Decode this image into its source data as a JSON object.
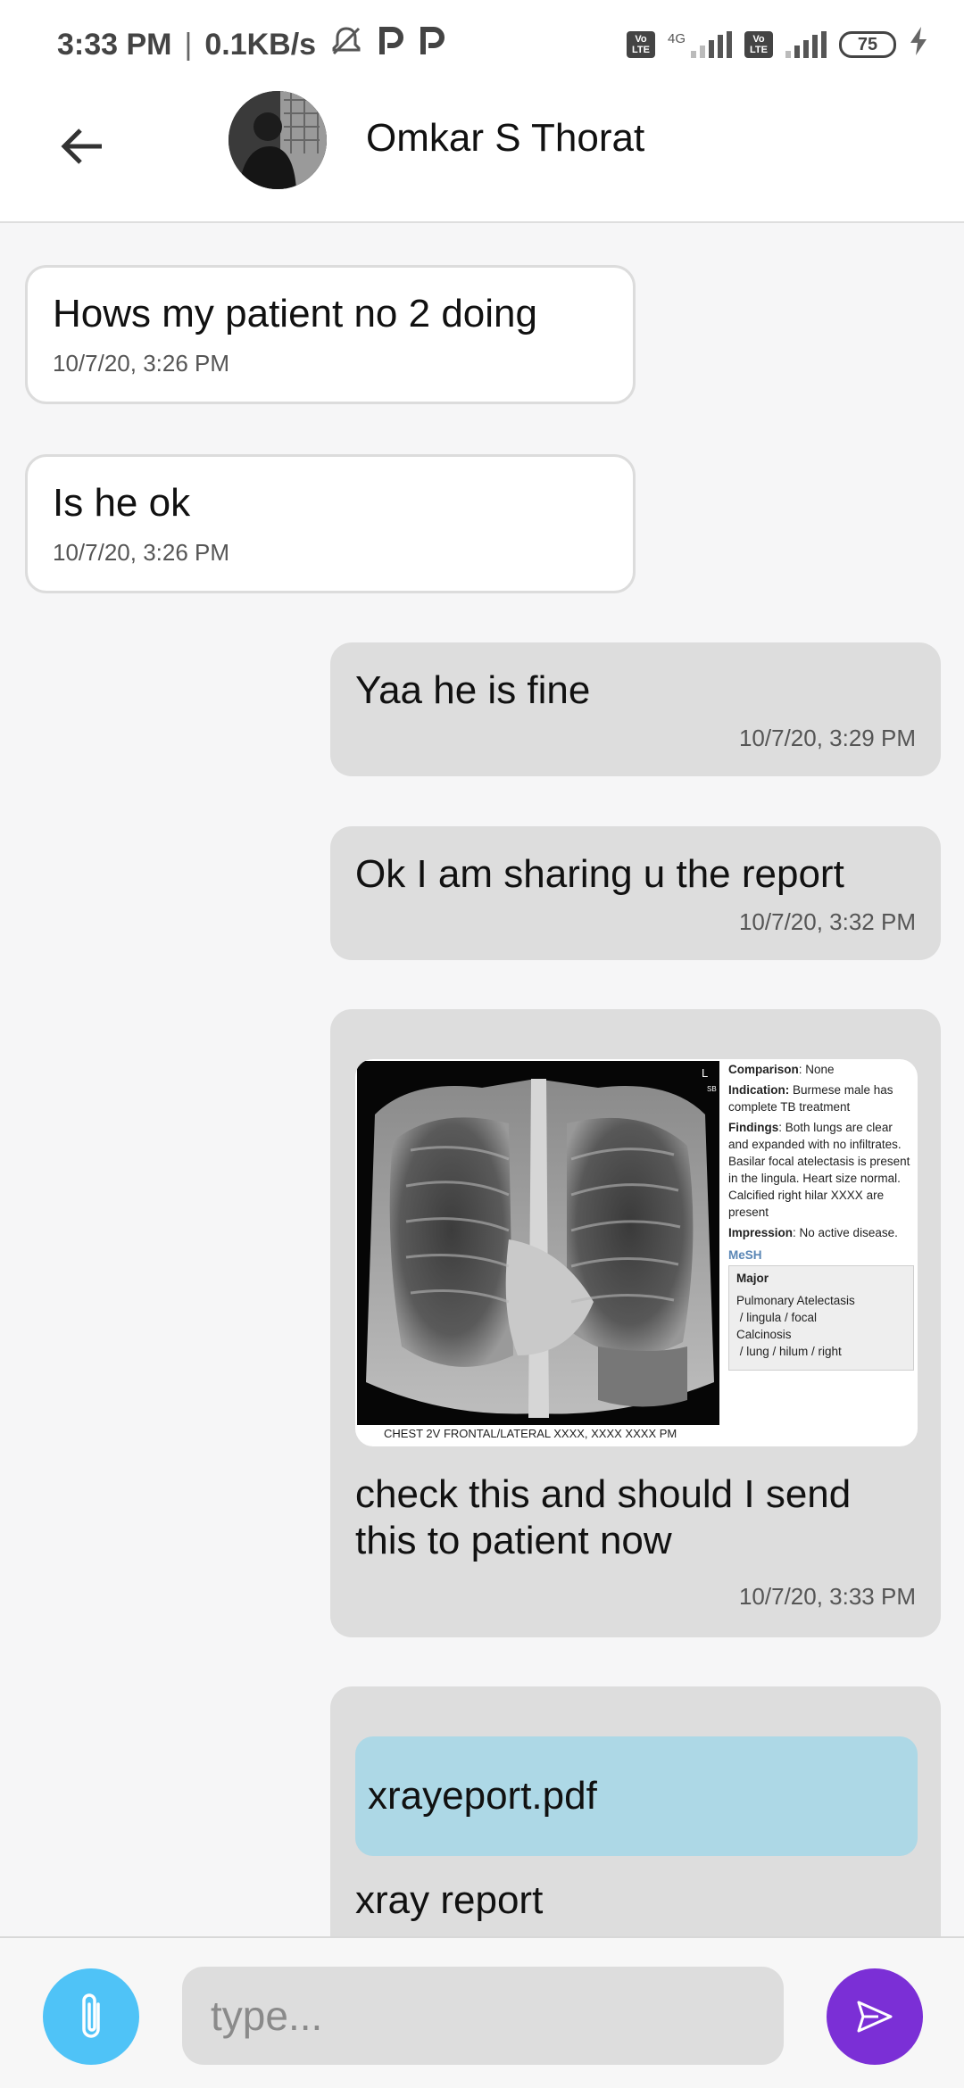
{
  "status_bar": {
    "time": "3:33 PM",
    "separator": "|",
    "speed": "0.1KB/s",
    "network_label": "4G",
    "volte_top": "Vo",
    "volte_bottom": "LTE",
    "battery": "75",
    "icons": [
      "mute-icon",
      "p-app-icon",
      "signal-icon",
      "battery-icon",
      "charging-icon"
    ]
  },
  "header": {
    "contact_name": "Omkar S Thorat",
    "back_icon": "arrow-left-icon"
  },
  "messages": [
    {
      "direction": "incoming",
      "text": "Hows my patient no 2 doing",
      "time": "10/7/20, 3:26 PM"
    },
    {
      "direction": "incoming",
      "text": "Is he ok",
      "time": "10/7/20, 3:26 PM"
    },
    {
      "direction": "outgoing",
      "text": "Yaa he is fine",
      "time": "10/7/20, 3:29 PM"
    },
    {
      "direction": "outgoing",
      "text": "Ok I am sharing u the report",
      "time": "10/7/20, 3:32 PM"
    },
    {
      "direction": "outgoing",
      "text": "check this and should I send this to patient now",
      "time": "10/7/20, 3:33 PM",
      "attachment": {
        "type": "image",
        "marker_l": "L",
        "marker_sb": "SB",
        "comparison_label": "Comparison",
        "comparison": ": None",
        "indication_label": "Indication:",
        "indication": " Burmese male has complete TB treatment",
        "findings_label": "Findings",
        "findings": ": Both lungs are clear and expanded with no infiltrates. Basilar focal atelectasis is present in the lingula. Heart size normal. Calcified right hilar XXXX are present",
        "impression_label": "Impression",
        "impression": ": No active disease.",
        "mesh_label": "MeSH",
        "major_label": "Major",
        "major_line1": "Pulmonary Atelectasis",
        "major_line2": " / lingula / focal",
        "major_line3": "Calcinosis",
        "major_line4": " / lung / hilum / right",
        "caption": "CHEST 2V FRONTAL/LATERAL XXXX, XXXX XXXX PM"
      }
    },
    {
      "direction": "outgoing",
      "text": "xray report",
      "attachment": {
        "type": "file",
        "filename": "xrayeport.pdf"
      }
    }
  ],
  "composer": {
    "placeholder": "type...",
    "attach_icon": "paperclip-icon",
    "send_icon": "send-icon",
    "colors": {
      "attach": "#4fc3f7",
      "send": "#7b2fd6",
      "file_box": "#add8e6"
    }
  }
}
